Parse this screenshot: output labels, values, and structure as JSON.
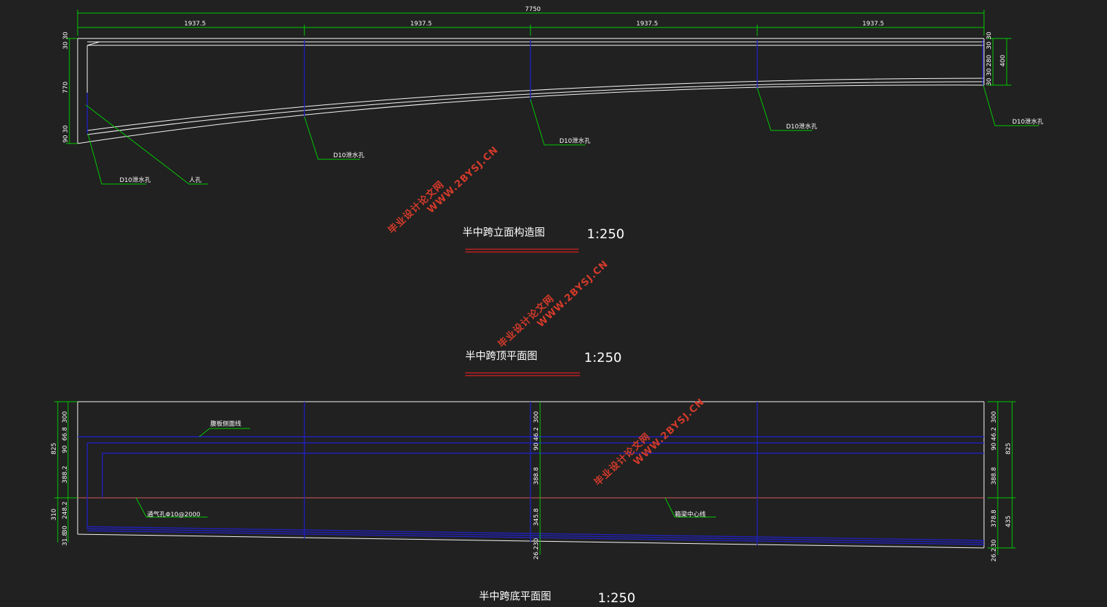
{
  "drawings": {
    "elevation": {
      "title": "半中跨立面构造图",
      "scale": "1:250",
      "overall_dim": "7750",
      "segment_dims": [
        "1937.5",
        "1937.5",
        "1937.5",
        "1937.5"
      ],
      "left_dims": [
        "30 30",
        "770",
        "90 30"
      ],
      "right_dims": [
        "30 30",
        "280",
        "30 30",
        "400"
      ],
      "notes": {
        "drain_1": "D10泄水孔",
        "manhole": "人孔",
        "drain_2": "D10泄水孔",
        "drain_3": "D10泄水孔",
        "drain_4": "D10泄水孔",
        "drain_5": "D10泄水孔"
      }
    },
    "top_plan": {
      "title": "半中跨顶平面图",
      "scale": "1:250"
    },
    "bottom_plan": {
      "title": "半中跨底平面图",
      "scale": "1:250",
      "left_dims": [
        "300",
        "66.8",
        "90",
        "825",
        "388.2",
        "310",
        "248.2",
        "30",
        "31.8"
      ],
      "mid_dims": [
        "300",
        "46.2",
        "90",
        "388.8",
        "345.8",
        "30",
        "26.2"
      ],
      "right_dims": [
        "300",
        "46.2",
        "90",
        "825",
        "388.8",
        "378.8",
        "435",
        "30",
        "26.2"
      ],
      "notes": {
        "web_edge": "腹板侧面线",
        "vent": "通气孔Φ10@2000",
        "centerline": "箱梁中心线"
      }
    }
  },
  "watermarks": [
    {
      "line1": "毕业设计论文网",
      "line2": "WWW.2BYSJ.CN"
    },
    {
      "line1": "毕业设计论文网",
      "line2": "WWW.2BYSJ.CN"
    },
    {
      "line1": "毕业设计论文网",
      "line2": "WWW.2BYSJ.CN"
    }
  ],
  "colors": {
    "background": "#212121",
    "outline": "#ffffff",
    "dimension": "#00d000",
    "section_line": "#2020c0",
    "centerline": "#e06060",
    "underline": "#c02020",
    "watermark": "#d23a2a"
  }
}
